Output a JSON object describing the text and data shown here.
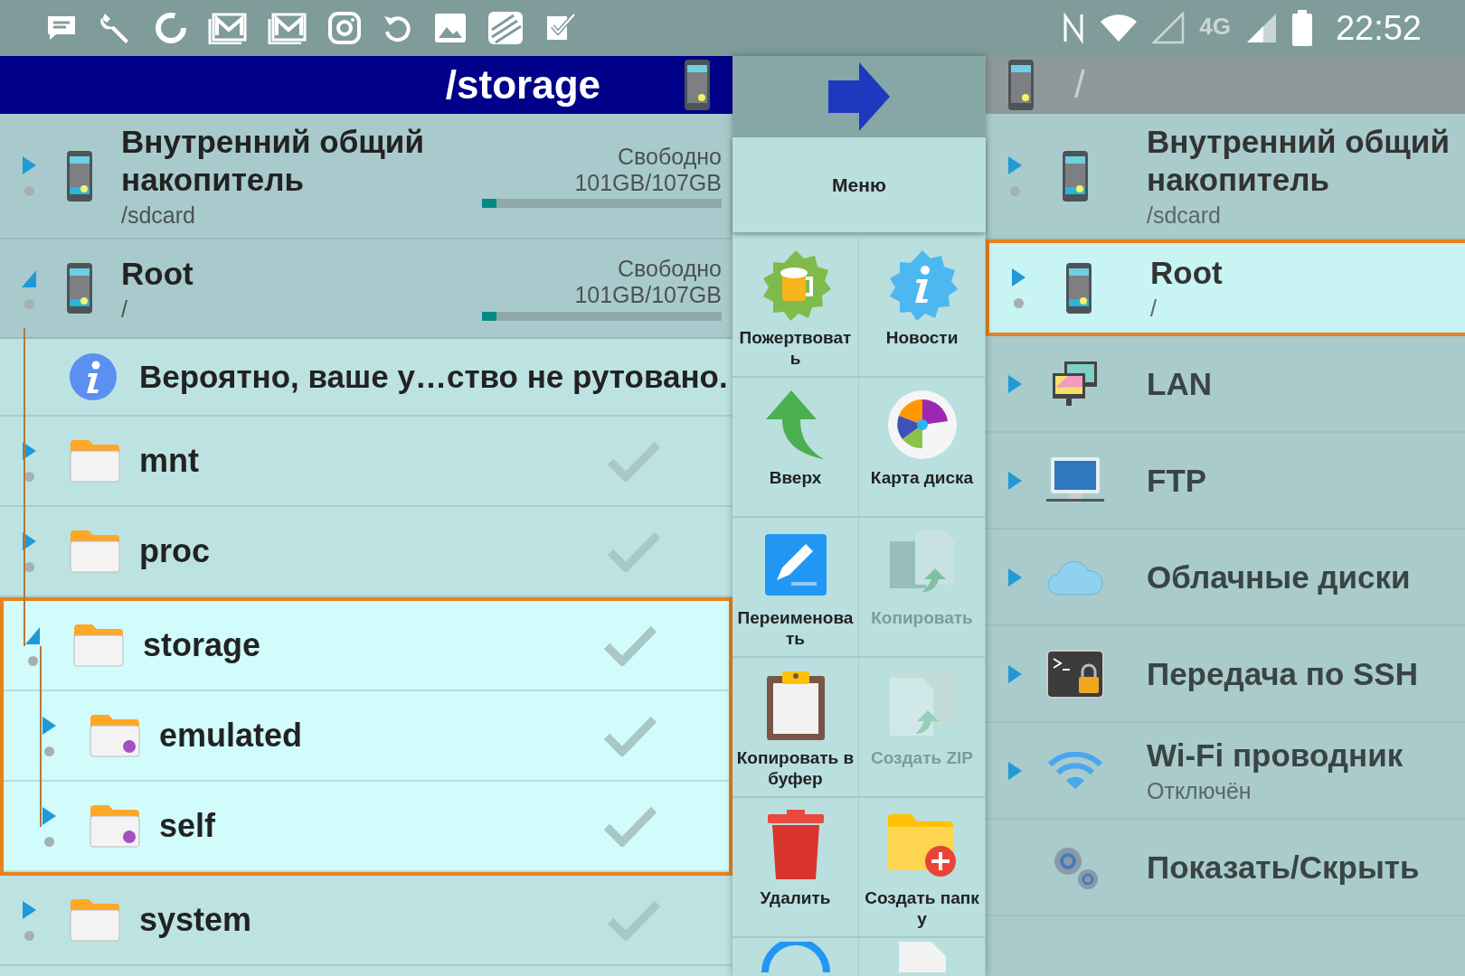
{
  "status_bar": {
    "network_type": "4G",
    "time": "22:52"
  },
  "left_panel": {
    "header": {
      "title": "/storage",
      "active": true
    },
    "storages": [
      {
        "name": "Внутренний общий накопитель",
        "path": "/sdcard",
        "free_label": "Свободно",
        "free_value": "101GB/107GB",
        "level": 0.06,
        "expanded": false
      },
      {
        "name": "Root",
        "path": "/",
        "free_label": "Свободно",
        "free_value": "101GB/107GB",
        "level": 0.06,
        "expanded": true
      }
    ],
    "notice": "Вероятно, ваше у…ство не рутовано.",
    "tree": [
      {
        "name": "mnt",
        "kind": "folder",
        "expanded": false,
        "selected": false,
        "checked": false
      },
      {
        "name": "proc",
        "kind": "folder",
        "expanded": false,
        "selected": false,
        "checked": false
      },
      {
        "name": "storage",
        "kind": "folder",
        "expanded": true,
        "selected": true,
        "checked": false,
        "children": [
          {
            "name": "emulated",
            "kind": "link",
            "expanded": false,
            "checked": false
          },
          {
            "name": "self",
            "kind": "link",
            "expanded": false,
            "checked": false
          }
        ]
      },
      {
        "name": "system",
        "kind": "folder",
        "expanded": false,
        "selected": false,
        "checked": false
      }
    ]
  },
  "menu": {
    "title": "Меню",
    "items": [
      {
        "label": "Пожертвовать",
        "kind": "donate",
        "disabled": false
      },
      {
        "label": "Новости",
        "kind": "news",
        "disabled": false
      },
      {
        "label": "Вверх",
        "kind": "up",
        "disabled": false
      },
      {
        "label": "Карта диска",
        "kind": "diskmap",
        "disabled": false
      },
      {
        "label": "Переименовать",
        "kind": "rename",
        "disabled": false
      },
      {
        "label": "Копировать",
        "kind": "copy",
        "disabled": true
      },
      {
        "label": "Копировать в буфер",
        "kind": "clipboard",
        "disabled": false
      },
      {
        "label": "Создать ZIP",
        "kind": "zip",
        "disabled": true
      },
      {
        "label": "Удалить",
        "kind": "delete",
        "disabled": false
      },
      {
        "label": "Создать папку",
        "kind": "newfolder",
        "disabled": false
      },
      {
        "kind": "ring",
        "disabled": false
      },
      {
        "kind": "document",
        "disabled": false
      }
    ]
  },
  "right_panel": {
    "header": {
      "title": "/",
      "active": false
    },
    "items": [
      {
        "kind": "storage",
        "title": "Внутренний общий накопитель",
        "subtitle": "/sdcard",
        "expandable": true,
        "selected": false
      },
      {
        "kind": "storage",
        "title": "Root",
        "subtitle": "/",
        "expandable": true,
        "selected": true
      },
      {
        "kind": "lan",
        "title": "LAN",
        "expandable": true,
        "selected": false
      },
      {
        "kind": "ftp",
        "title": "FTP",
        "expandable": true,
        "selected": false
      },
      {
        "kind": "cloud",
        "title": "Облачные диски",
        "expandable": true,
        "selected": false
      },
      {
        "kind": "ssh",
        "title": "Передача по SSH",
        "expandable": true,
        "selected": false
      },
      {
        "kind": "wifi",
        "title": "Wi-Fi проводник",
        "subtitle": "Отключён",
        "expandable": true,
        "selected": false
      },
      {
        "kind": "settings",
        "title": "Показать/Скрыть",
        "expandable": false,
        "selected": false
      }
    ]
  }
}
